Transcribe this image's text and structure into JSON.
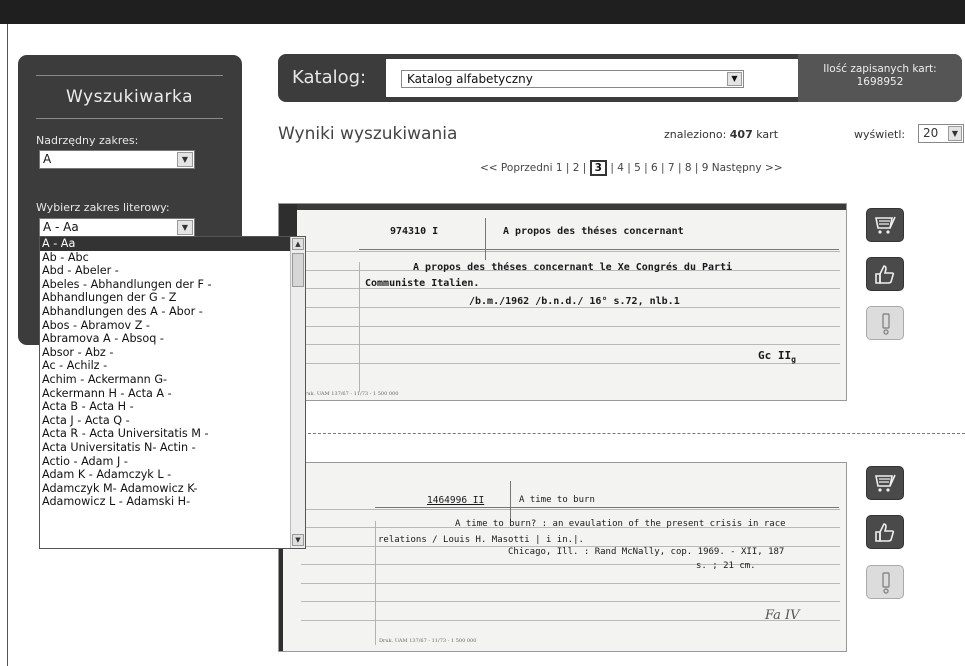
{
  "sidebar": {
    "title": "Wyszukiwarka",
    "parent_range_label": "Nadrzędny zakres:",
    "parent_range_value": "A",
    "letter_range_label": "Wybierz zakres literowy:",
    "letter_range_value": "A - Aa",
    "dropdown_options": [
      "A - Aa",
      "Ab - Abc",
      "Abd - Abeler -",
      "Abeles - Abhandlungen der F -",
      "Abhandlungen der G - Z",
      "Abhandlungen des A - Abor -",
      "Abos - Abramov Z -",
      "Abramova A - Absoq -",
      "Absor - Abz -",
      "Ac - Achilz -",
      "Achim - Ackermann G-",
      "Ackermann H - Acta A -",
      "Acta B - Acta H -",
      "Acta J - Acta Q -",
      "Acta R - Acta Universitatis M -",
      "Acta Universitatis N- Actin -",
      "Actio - Adam J -",
      "Adam K - Adamczyk L -",
      "Adamczyk M- Adamowicz K-",
      "Adamowicz L - Adamski H-"
    ]
  },
  "catalog": {
    "label": "Katalog:",
    "selected": "Katalog alfabetyczny",
    "saved_cards_label": "Ilość zapisanych kart:",
    "saved_cards_count": "1698952"
  },
  "results": {
    "title": "Wyniki wyszukiwania",
    "found_prefix": "znaleziono:",
    "found_count": "407",
    "found_suffix": "kart",
    "show_label": "wyświetl:",
    "show_value": "20",
    "pager": {
      "prev": "<< Poprzedni",
      "pages": [
        "1",
        "2",
        "3",
        "4",
        "5",
        "6",
        "7",
        "8",
        "9"
      ],
      "current": "3",
      "next": "Następny >>"
    }
  },
  "cards": [
    {
      "number": "974310 I",
      "heading": "A propos des théses concernant",
      "line1": "A propos des théses concernant le Xe Congrés du Parti",
      "line2": "Communiste Italien.",
      "line3": "/b.m./1962      /b.n.d./     16°     s.72, nlb.1",
      "signature": "Gc II",
      "signature_sub": "g",
      "printer": "Druk. UAM 137/67 - 11/73 - 1 500 000"
    },
    {
      "number": "1464996 II",
      "heading": "A time to burn",
      "line1": "A time to burn? : an evaulation of the present crisis in race",
      "line2": "relations / Louis H. Masotti | i in.|.",
      "line3": "Chicago, Ill. : Rand McNally, cop. 1969. - XII, 187",
      "line4": "s. ; 21 cm.",
      "signature": "Fa IV",
      "printer": "Druk. UAM 137/67 - 11/73 - 1 500 000"
    }
  ],
  "icons": {
    "cart": "cart-icon",
    "thumb": "thumbs-up-icon",
    "report": "exclamation-icon"
  }
}
